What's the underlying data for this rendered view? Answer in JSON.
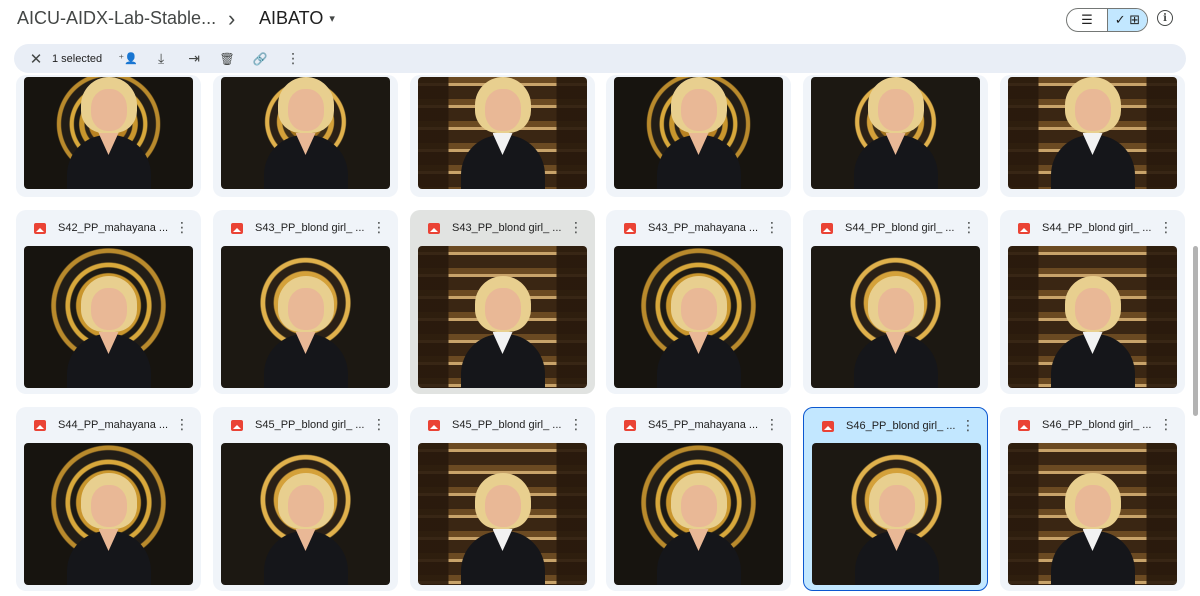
{
  "header": {
    "breadcrumb_root": "AICU-AIDX-Lab-Stable...",
    "breadcrumb_sep": "›",
    "current_folder": "AIBATO",
    "caret": "▾"
  },
  "view_toggle": {
    "list_icon": "☰",
    "grid_icon": "✓ ⊞"
  },
  "info_icon": "i",
  "selection_bar": {
    "close_icon": "✕",
    "selected_label": "1 selected",
    "share_icon": "⁺👤",
    "download_icon": "⤓",
    "move_icon": "⇥",
    "delete_icon": "🗑",
    "link_icon": "🔗",
    "more_icon": "⋮"
  },
  "files": {
    "row2": [
      {
        "name": "S42_PP_mahayana ...",
        "more": "⋮"
      },
      {
        "name": "S43_PP_blond girl_ ...",
        "more": "⋮"
      },
      {
        "name": "S43_PP_blond girl_ ...",
        "more": "⋮"
      },
      {
        "name": "S43_PP_mahayana ...",
        "more": "⋮"
      },
      {
        "name": "S44_PP_blond girl_ ...",
        "more": "⋮"
      },
      {
        "name": "S44_PP_blond girl_ ...",
        "more": "⋮"
      }
    ],
    "row3": [
      {
        "name": "S44_PP_mahayana ...",
        "more": "⋮"
      },
      {
        "name": "S45_PP_blond girl_ ...",
        "more": "⋮"
      },
      {
        "name": "S45_PP_blond girl_ ...",
        "more": "⋮"
      },
      {
        "name": "S45_PP_mahayana ...",
        "more": "⋮"
      },
      {
        "name": "S46_PP_blond girl_ ...",
        "more": "⋮"
      },
      {
        "name": "S46_PP_blond girl_ ...",
        "more": "⋮"
      }
    ]
  },
  "colors": {
    "selected_bg": "#c2e7ff",
    "selected_border": "#0b57d0",
    "card_bg": "#f0f4f9",
    "image_icon": "#ea4335"
  }
}
